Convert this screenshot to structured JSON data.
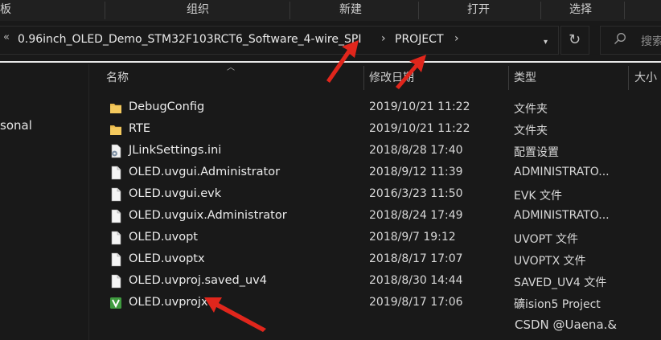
{
  "ribbon": {
    "share_partial": "板",
    "organize": "组织",
    "new": "新建",
    "open": "打开",
    "select": "选择"
  },
  "address": {
    "overflow": "«",
    "parent": "0.96inch_OLED_Demo_STM32F103RCT6_Software_4-wire_SPI",
    "current": "PROJECT",
    "separator": "›"
  },
  "search": {
    "placeholder": "搜索"
  },
  "nav": {
    "partial_item": "sonal"
  },
  "columns": {
    "name": "名称",
    "date": "修改日期",
    "type": "类型",
    "size": "大小"
  },
  "files": [
    {
      "name": "DebugConfig",
      "date": "2019/10/21 11:22",
      "type": "文件夹",
      "icon": "folder-icon"
    },
    {
      "name": "RTE",
      "date": "2019/10/21 11:22",
      "type": "文件夹",
      "icon": "folder-icon"
    },
    {
      "name": "JLinkSettings.ini",
      "date": "2018/8/28 17:40",
      "type": "配置设置",
      "icon": "settings-file-icon"
    },
    {
      "name": "OLED.uvgui.Administrator",
      "date": "2018/9/12 11:39",
      "type": "ADMINISTRATO...",
      "icon": "file-icon"
    },
    {
      "name": "OLED.uvgui.evk",
      "date": "2016/3/23 11:50",
      "type": "EVK 文件",
      "icon": "file-icon"
    },
    {
      "name": "OLED.uvguix.Administrator",
      "date": "2018/8/24 17:49",
      "type": "ADMINISTRATO...",
      "icon": "file-icon"
    },
    {
      "name": "OLED.uvopt",
      "date": "2018/9/7 19:12",
      "type": "UVOPT 文件",
      "icon": "file-icon"
    },
    {
      "name": "OLED.uvoptx",
      "date": "2018/8/17 17:07",
      "type": "UVOPTX 文件",
      "icon": "file-icon"
    },
    {
      "name": "OLED.uvproj.saved_uv4",
      "date": "2018/8/30 14:44",
      "type": "SAVED_UV4 文件",
      "icon": "file-icon"
    },
    {
      "name": "OLED.uvprojx",
      "date": "2019/8/17 17:06",
      "type": "礦ision5 Project",
      "icon": "keil-project-icon"
    }
  ],
  "watermark": "CSDN @Uaena.&",
  "colors": {
    "background": "#191919",
    "folder": "#e8b84a",
    "annotation_arrow": "#e0261c",
    "keil_green": "#3f9b3f"
  }
}
